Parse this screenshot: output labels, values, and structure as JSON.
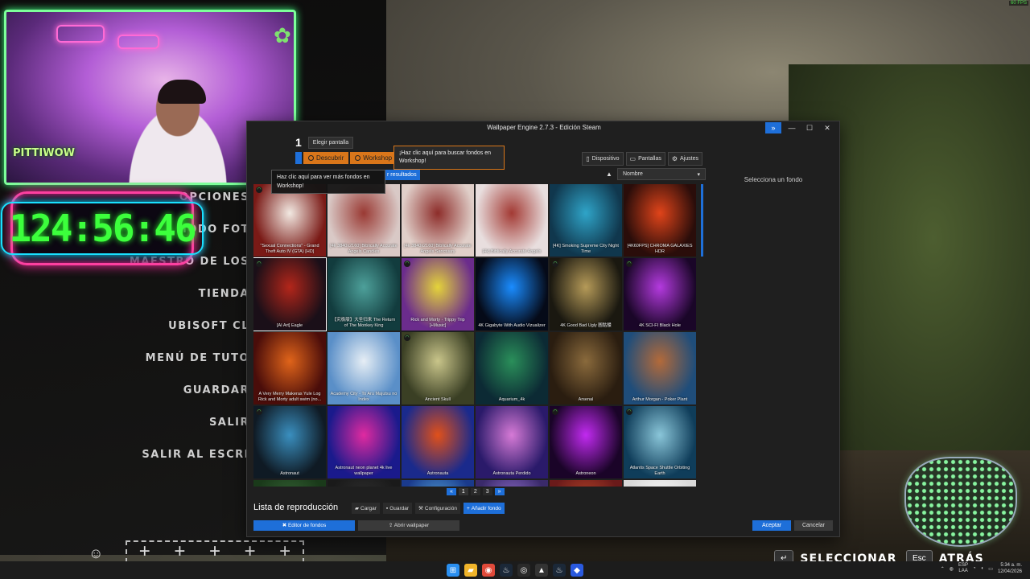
{
  "game": {
    "menu": [
      "OPCIONES",
      "MODO FOT",
      "MAESTRO DE LOS",
      "TIENDA",
      "UBISOFT CL",
      "MENÚ DE TUTO",
      "GUARDAR",
      "SALIR",
      "SALIR AL ESCRI"
    ],
    "prompt_select_key": "↵",
    "prompt_select_label": "SELECCIONAR",
    "prompt_back_key": "Esc",
    "prompt_back_label": "ATRÁS"
  },
  "overlay": {
    "timer": "124:56:46",
    "cam_logo": "PITTIWOW",
    "fps": "60 FPS"
  },
  "window": {
    "title": "Wallpaper Engine 2.7.3 - Edición Steam",
    "screen_number": "1",
    "choose_screen": "Elegir pantalla",
    "tabs": {
      "discover": "Descubrir",
      "workshop": "Workshop"
    },
    "tooltip_workshop": "¡Haz clic aquí para buscar fondos en Workshop!",
    "tooltip_discover": "Haz clic aquí para ver más fondos en Workshop!",
    "filter_button": "r resultados",
    "right_tabs": {
      "device": "Dispositivo",
      "screens": "Pantallas",
      "settings": "Ajustes"
    },
    "sort": "Nombre",
    "side_panel": "Selecciona un fondo",
    "pager": {
      "prev": "«",
      "pages": [
        "1",
        "2",
        "3"
      ],
      "next": "»"
    },
    "playlist": {
      "title": "Lista de reproducción",
      "load": "Cargar",
      "save": "Guardar",
      "config": "Configuración",
      "add": "Añadir fondo"
    },
    "editor_btn": "Editor de fondos",
    "open_btn": "Abrir wallpaper",
    "accept": "Aceptar",
    "cancel": "Cancelar"
  },
  "tiles": [
    {
      "label": "\"Sexual Connections\" - Grand Theft Auto IV (GTA) [HD]",
      "color": "#7a1a16",
      "color2": "#f2e9e2",
      "badge": true
    },
    {
      "label": "[4k 3840x2160] Biblically Accurate Angels Candies",
      "color": "#d9c9c6",
      "color2": "#9a3a34",
      "badge": false
    },
    {
      "label": "[4k 3840x2160] Biblically Accurate Angels Sanctuary",
      "color": "#e0cfc9",
      "color2": "#8d2d2a",
      "badge": false
    },
    {
      "label": "[4k] Biblically Accurate Angels",
      "color": "#e8dede",
      "color2": "#a33a34",
      "badge": false
    },
    {
      "label": "[4K] Smoking Supreme City Night Time",
      "color": "#10374d",
      "color2": "#2fa4c8",
      "badge": false
    },
    {
      "label": "[4K60FPS] CHROMA GALAXIES HDR",
      "color": "#2a0d0a",
      "color2": "#e0441a",
      "badge": false
    },
    {
      "label": "[AI Art] Eagle",
      "color": "#1a0f18",
      "color2": "#b3261a",
      "badge": true
    },
    {
      "label": "【究极版】大圣归来 The Return of The Monkey King",
      "color": "#123c3e",
      "color2": "#4da09a",
      "badge": false
    },
    {
      "label": "Rick and Morty · Trippy Trip [+Music]",
      "color": "#6b2c8c",
      "color2": "#e4d33a",
      "badge": true
    },
    {
      "label": "4K Gigabyte With Audio Vizualizer",
      "color": "#050a18",
      "color2": "#1a8cff",
      "badge": false
    },
    {
      "label": "4K Good Bad Ugly 圖骷髅",
      "color": "#1a1810",
      "color2": "#b59a58",
      "badge": true
    },
    {
      "label": "4K SCI-FI Black Hole",
      "color": "#1a0628",
      "color2": "#b43adf",
      "badge": true
    },
    {
      "label": "A Very Merry Makeras Yule Log Rick and Morty adult swim (no...",
      "color": "#4a0d0a",
      "color2": "#e0641a",
      "badge": false
    },
    {
      "label": "Academy City - To Aru Majutsu no Index",
      "color": "#5a8fc8",
      "color2": "#e6eef5",
      "badge": false
    },
    {
      "label": "Ancient Skull",
      "color": "#3a3f24",
      "color2": "#c9c58a",
      "badge": true
    },
    {
      "label": "Aquarium_4k",
      "color": "#0c2a34",
      "color2": "#2a8f5a",
      "badge": false
    },
    {
      "label": "Arsenal",
      "color": "#2a1d10",
      "color2": "#8a6a3c",
      "badge": false
    },
    {
      "label": "Arthur Morgan - Poker Plant",
      "color": "#1f4d7a",
      "color2": "#b36a3a",
      "badge": false
    },
    {
      "label": "Astronaut",
      "color": "#0f1a24",
      "color2": "#3a8fbf",
      "badge": true
    },
    {
      "label": "Astronaut neon planet 4k live wallpaper",
      "color": "#1a1a8c",
      "color2": "#e02aa0",
      "badge": false
    },
    {
      "label": "Astronauta",
      "color": "#1a2a8c",
      "color2": "#e0501a",
      "badge": false
    },
    {
      "label": "Astronauta Perdido",
      "color": "#2a1a6a",
      "color2": "#d67ad6",
      "badge": false
    },
    {
      "label": "Astroneon",
      "color": "#1a0428",
      "color2": "#c12af0",
      "badge": true
    },
    {
      "label": "Atlantis Space Shuttle Orbiting Earth",
      "color": "#0f3d5a",
      "color2": "#8ac6d9",
      "badge": true
    },
    {
      "label": "",
      "color": "#1a3a1a",
      "color2": "#3a6a3a",
      "badge": false
    },
    {
      "label": "",
      "color": "#1a1a1a",
      "color2": "#333333",
      "badge": false
    },
    {
      "label": "",
      "color": "#1a3a8c",
      "color2": "#5ab0e0",
      "badge": false
    },
    {
      "label": "",
      "color": "#3a2a6a",
      "color2": "#a07ae0",
      "badge": false
    },
    {
      "label": "",
      "color": "#6a1a1a",
      "color2": "#c04a2a",
      "badge": false
    },
    {
      "label": "",
      "color": "#d9d9d9",
      "color2": "#ffffff",
      "badge": false
    }
  ],
  "taskbar": {
    "icons": [
      {
        "name": "windows-start-icon",
        "glyph": "⊞",
        "color": "#2a8ff0"
      },
      {
        "name": "file-explorer-icon",
        "glyph": "▰",
        "color": "#f0b42a"
      },
      {
        "name": "chrome-icon",
        "glyph": "◉",
        "color": "#e04a3a"
      },
      {
        "name": "steam-icon",
        "glyph": "♨",
        "color": "#1b2838"
      },
      {
        "name": "obs-icon",
        "glyph": "◎",
        "color": "#2a2a2a"
      },
      {
        "name": "epic-icon",
        "glyph": "▲",
        "color": "#333333"
      },
      {
        "name": "steam-icon-2",
        "glyph": "♨",
        "color": "#1b2838"
      },
      {
        "name": "app-icon",
        "glyph": "◆",
        "color": "#2a5ae0"
      }
    ],
    "lang_top": "ESP",
    "lang_bottom": "LAA",
    "time": "5:34 a. m.",
    "date": "12/04/2026"
  }
}
